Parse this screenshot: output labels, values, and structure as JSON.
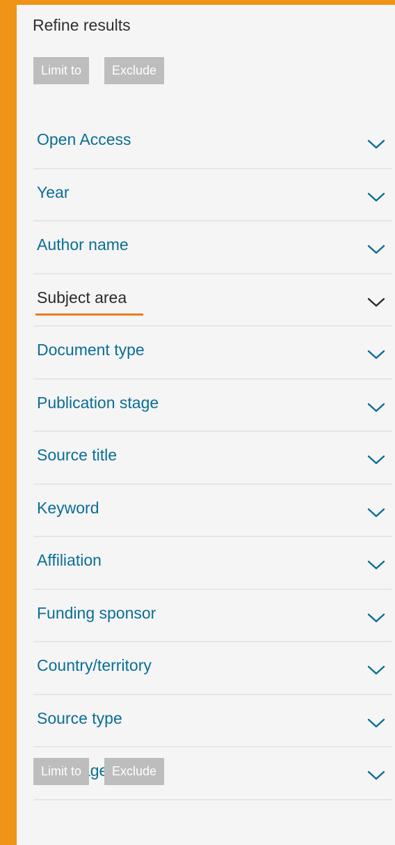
{
  "panel": {
    "title": "Refine results",
    "top_buttons": {
      "limit_label": "Limit to",
      "exclude_label": "Exclude"
    },
    "bottom_buttons": {
      "limit_label": "Limit to",
      "exclude_label": "Exclude"
    }
  },
  "facets": [
    {
      "id": "open-access",
      "label": "Open Access",
      "active": false
    },
    {
      "id": "year",
      "label": "Year",
      "active": false
    },
    {
      "id": "author-name",
      "label": "Author name",
      "active": false
    },
    {
      "id": "subject-area",
      "label": "Subject area",
      "active": true
    },
    {
      "id": "document-type",
      "label": "Document type",
      "active": false
    },
    {
      "id": "publication-stage",
      "label": "Publication stage",
      "active": false
    },
    {
      "id": "source-title",
      "label": "Source title",
      "active": false
    },
    {
      "id": "keyword",
      "label": "Keyword",
      "active": false
    },
    {
      "id": "affiliation",
      "label": "Affiliation",
      "active": false
    },
    {
      "id": "funding-sponsor",
      "label": "Funding sponsor",
      "active": false
    },
    {
      "id": "country-territory",
      "label": "Country/territory",
      "active": false
    },
    {
      "id": "source-type",
      "label": "Source type",
      "active": false
    },
    {
      "id": "language",
      "label": "Language",
      "active": false
    }
  ],
  "colors": {
    "accent": "#ef9416",
    "link": "#0a6e96",
    "active_underline": "#ef7a1a",
    "button_bg": "#bdbdbd",
    "panel_bg": "#f5f5f5"
  },
  "icons": {
    "facet_toggle": "chevron-down-icon"
  }
}
